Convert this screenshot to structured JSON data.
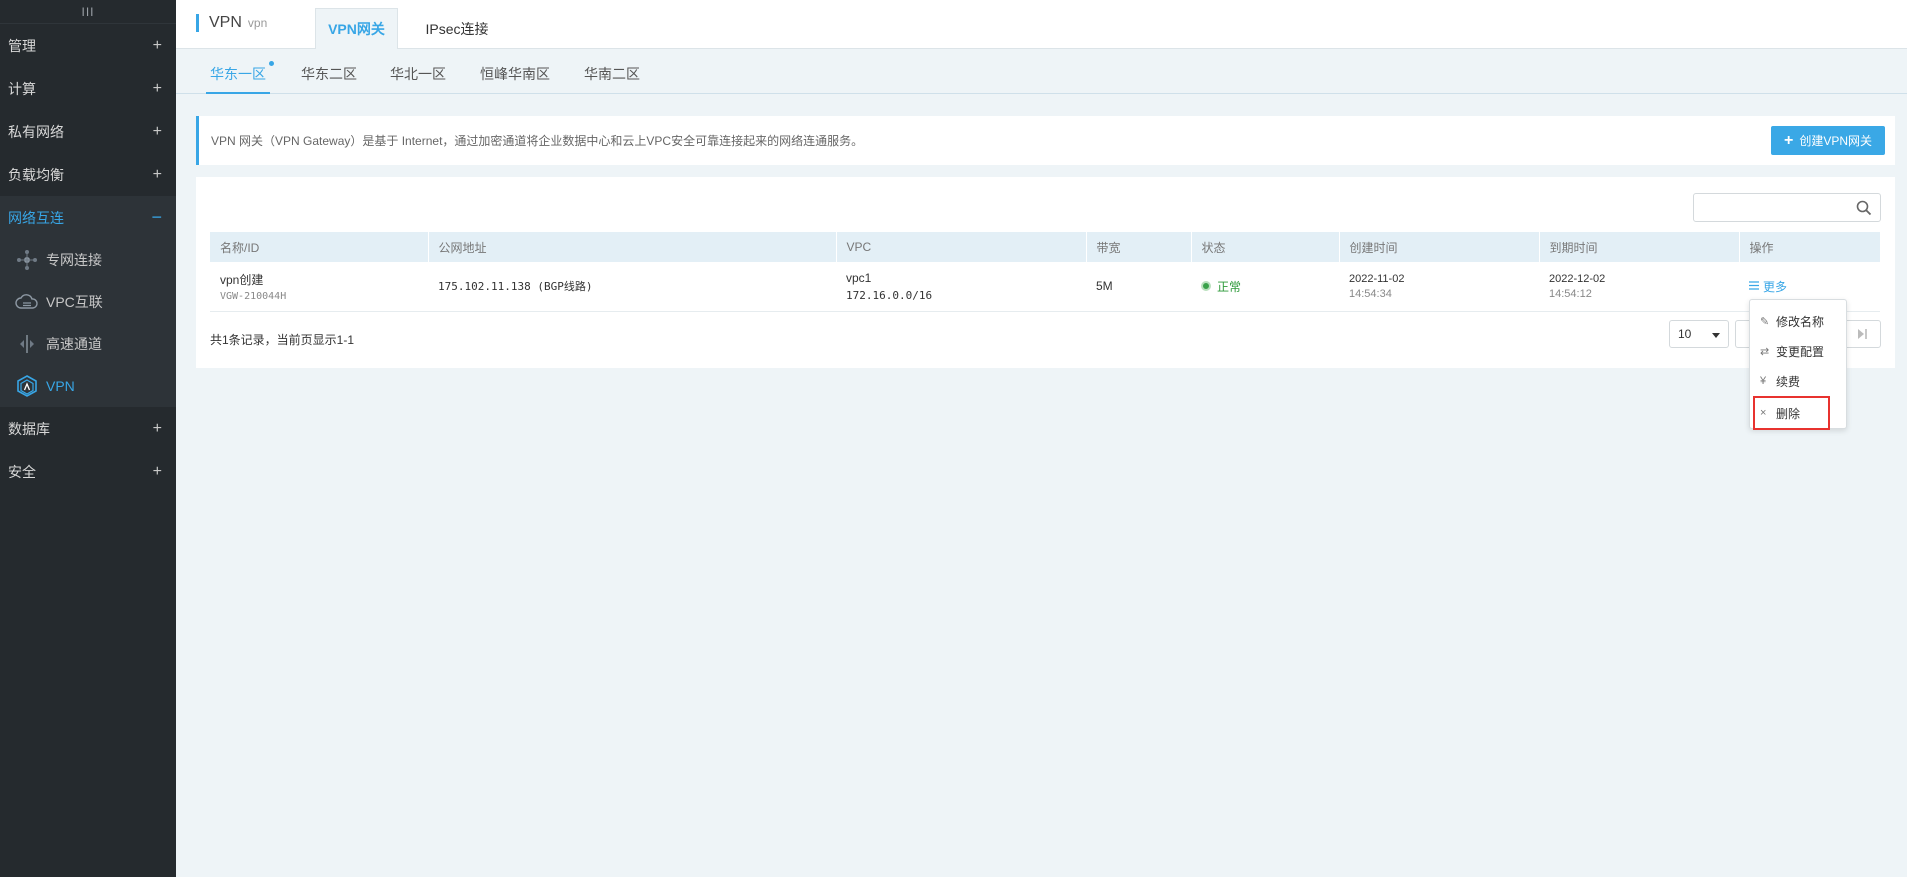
{
  "sidebar": {
    "toggle": "III",
    "items": [
      {
        "label": "管理",
        "icon": "+"
      },
      {
        "label": "计算",
        "icon": "+"
      },
      {
        "label": "私有网络",
        "icon": "+"
      },
      {
        "label": "负载均衡",
        "icon": "+"
      },
      {
        "label": "网络互连",
        "icon": "−"
      }
    ],
    "sub_items": [
      {
        "label": "专网连接"
      },
      {
        "label": "VPC互联"
      },
      {
        "label": "高速通道"
      },
      {
        "label": "VPN"
      }
    ],
    "items_after": [
      {
        "label": "数据库",
        "icon": "+"
      },
      {
        "label": "安全",
        "icon": "+"
      }
    ]
  },
  "header": {
    "title": "VPN",
    "subtitle": "vpn",
    "tabs": [
      {
        "label": "VPN网关"
      },
      {
        "label": "IPsec连接"
      }
    ]
  },
  "regions": [
    {
      "label": "华东一区"
    },
    {
      "label": "华东二区"
    },
    {
      "label": "华北一区"
    },
    {
      "label": "恒峰华南区"
    },
    {
      "label": "华南二区"
    }
  ],
  "banner": {
    "text": "VPN 网关（VPN Gateway）是基于 Internet，通过加密通道将企业数据中心和云上VPC安全可靠连接起来的网络连通服务。",
    "create_label": "创建VPN网关"
  },
  "search": {
    "placeholder": ""
  },
  "table": {
    "columns": [
      "名称/ID",
      "公网地址",
      "VPC",
      "带宽",
      "状态",
      "创建时间",
      "到期时间",
      "操作"
    ],
    "rows": [
      {
        "name": "vpn创建",
        "id": "VGW-210044H",
        "address": "175.102.11.138 (BGP线路)",
        "vpc_name": "vpc1",
        "vpc_cidr": "172.16.0.0/16",
        "bandwidth": "5M",
        "status": "正常",
        "created_date": "2022-11-02",
        "created_time": "14:54:34",
        "expire_date": "2022-12-02",
        "expire_time": "14:54:12",
        "action": "更多"
      }
    ]
  },
  "summary": "共1条记录，当前页显示1-1",
  "pager": {
    "page_size": "10"
  },
  "dropdown": [
    {
      "icon": "✎",
      "label": "修改名称"
    },
    {
      "icon": "⇄",
      "label": "变更配置"
    },
    {
      "icon": "¥",
      "label": "续费"
    },
    {
      "icon": "×",
      "label": "删除"
    }
  ],
  "colors": {
    "accent": "#38a6e6",
    "sidebar_bg": "#252a2e",
    "status_ok": "#2e9a3a",
    "highlight": "#e8322f"
  }
}
